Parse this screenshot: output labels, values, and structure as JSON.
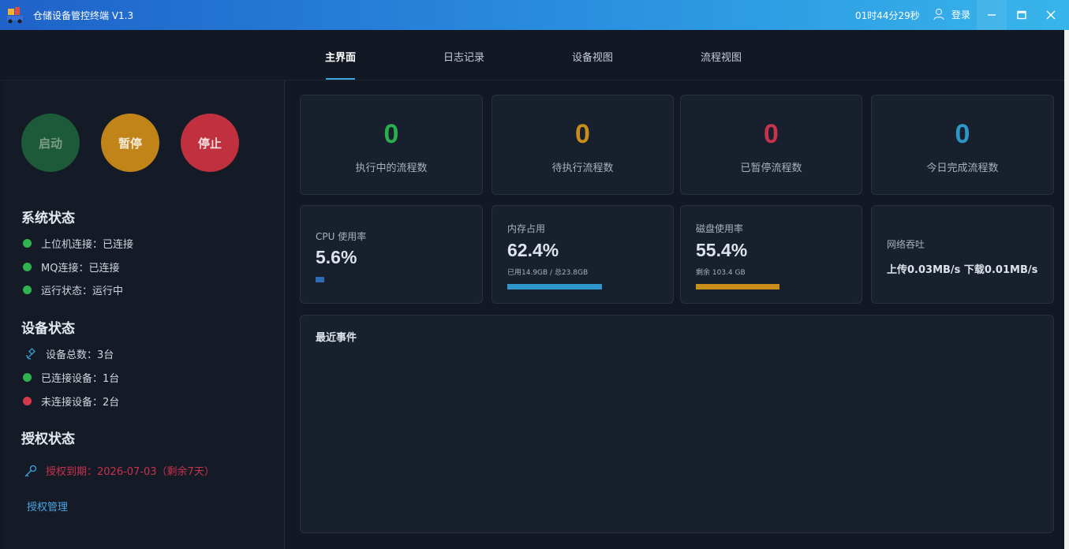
{
  "app": {
    "title": "仓储设备管控终端 V1.3",
    "clock": "01时44分29秒",
    "login_label": "登录"
  },
  "tabs": [
    {
      "label": "主界面",
      "active": true
    },
    {
      "label": "日志记录",
      "active": false
    },
    {
      "label": "设备视图",
      "active": false
    },
    {
      "label": "流程视图",
      "active": false
    }
  ],
  "controls": {
    "start_label": "启动",
    "pause_label": "暂停",
    "stop_label": "停止"
  },
  "system_status": {
    "title": "系统状态",
    "items": [
      {
        "text": "上位机连接：已连接",
        "status": "green"
      },
      {
        "text": "MQ连接：已连接",
        "status": "green"
      },
      {
        "text": "运行状态：运行中",
        "status": "green"
      }
    ]
  },
  "device_status": {
    "title": "设备状态",
    "total": "设备总数：3台",
    "connected": "已连接设备：1台",
    "disconnected": "未连接设备：2台"
  },
  "license": {
    "title": "授权状态",
    "expiry": "授权到期：2026-07-03（剩余7天）",
    "manage_label": "授权管理"
  },
  "stats": [
    {
      "value": "0",
      "label": "执行中的流程数",
      "color": "#27b04b"
    },
    {
      "value": "0",
      "label": "待执行流程数",
      "color": "#c98d1a"
    },
    {
      "value": "0",
      "label": "已暂停流程数",
      "color": "#c8324a"
    },
    {
      "value": "0",
      "label": "今日完成流程数",
      "color": "#2d97c9"
    }
  ],
  "metrics": {
    "cpu": {
      "label": "CPU 使用率",
      "value": "5.6%",
      "fill": 0.056,
      "color": "#2e6db5"
    },
    "memory": {
      "label": "内存占用",
      "value": "62.4%",
      "sub": "已用14.9GB / 总23.8GB",
      "fill": 0.624,
      "color": "#2d97c9"
    },
    "disk": {
      "label": "磁盘使用率",
      "value": "55.4%",
      "sub": "剩余 103.4 GB",
      "fill": 0.554,
      "color": "#c98d1a"
    },
    "network": {
      "label": "网络吞吐",
      "value": "上传0.03MB/s  下载0.01MB/s"
    }
  },
  "events": {
    "title": "最近事件"
  }
}
